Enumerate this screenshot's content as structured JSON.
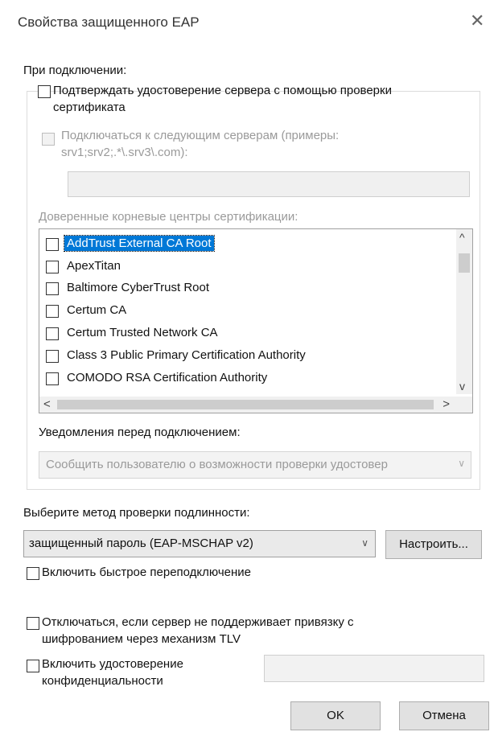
{
  "window": {
    "title": "Свойства защищенного EAP"
  },
  "on_connect": {
    "heading": "При подключении:",
    "verify_cert_label_l1": "Подтверждать удостоверение сервера с помощью проверки",
    "verify_cert_label_l2": "сертификата",
    "connect_servers_label_l1": "Подключаться к следующим серверам (примеры:",
    "connect_servers_label_l2": "srv1;srv2;.*\\.srv3\\.com):",
    "servers_value": "",
    "trusted_ca_heading": "Доверенные корневые центры сертификации:",
    "ca_items": [
      "AddTrust External CA Root",
      "ApexTitan",
      "Baltimore CyberTrust Root",
      "Certum CA",
      "Certum Trusted Network CA",
      "Class 3 Public Primary Certification Authority",
      "COMODO RSA Certification Authority"
    ],
    "notify_heading": "Уведомления перед подключением:",
    "notify_value": "Сообщить пользователю о возможности проверки удостовер"
  },
  "auth": {
    "heading": "Выберите метод проверки подлинности:",
    "method_value": "защищенный пароль (EAP-MSCHAP v2)",
    "configure_label": "Настроить...",
    "fast_reconnect_label": "Включить быстрое переподключение",
    "tlv_label_l1": "Отключаться, если сервер не поддерживает привязку с",
    "tlv_label_l2": "шифрованием через механизм TLV",
    "identity_label_l1": "Включить удостоверение",
    "identity_label_l2": "конфиденциальности",
    "identity_value": ""
  },
  "buttons": {
    "ok": "OK",
    "cancel": "Отмена"
  },
  "icons": {
    "close": "close-icon",
    "dropdown": "chevron-down-icon"
  }
}
